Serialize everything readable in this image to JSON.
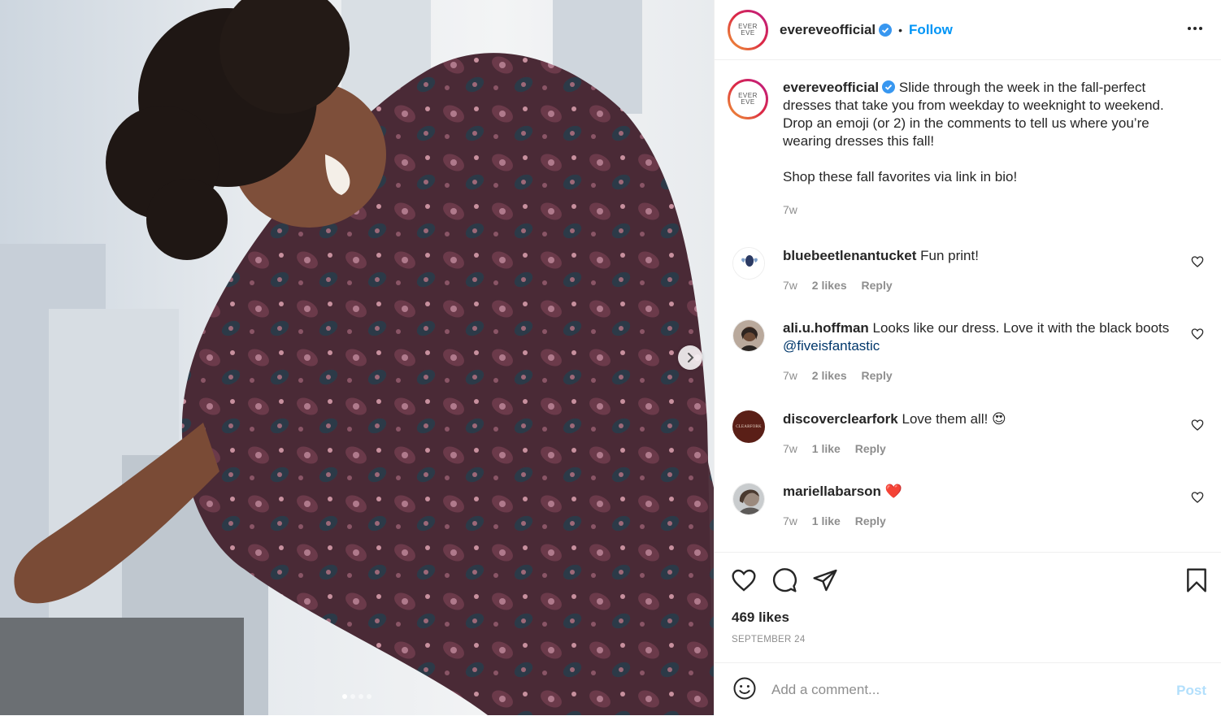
{
  "photo": {
    "alt": "",
    "carousel_dots": 4,
    "active_dot": 0
  },
  "header": {
    "avatar_text_top": "EVER",
    "avatar_text_bottom": "EVE",
    "username": "evereveofficial",
    "separator": "•",
    "follow_label": "Follow"
  },
  "caption": {
    "username": "evereveofficial",
    "text": "Slide through the week in the fall-perfect dresses that take you from weekday to weeknight to weekend. Drop an emoji (or 2) in the comments to tell us where you’re wearing dresses this fall!",
    "text2": "Shop these fall favorites via link in bio!",
    "time": "7w"
  },
  "comments": [
    {
      "username": "bluebeetlenantucket",
      "text": "Fun print!",
      "time": "7w",
      "likes": "2 likes",
      "reply": "Reply"
    },
    {
      "username": "ali.u.hoffman",
      "text": "Looks like our dress. Love it with the black boots",
      "mention": "@fiveisfantastic",
      "time": "7w",
      "likes": "2 likes",
      "reply": "Reply"
    },
    {
      "username": "discoverclearfork",
      "text": "Love them all! 😍",
      "time": "7w",
      "likes": "1 like",
      "reply": "Reply",
      "avatar_text": "CLEARFORK"
    },
    {
      "username": "mariellabarson",
      "text": "❤️",
      "time": "7w",
      "likes": "1 like",
      "reply": "Reply"
    }
  ],
  "actions": {
    "likes": "469 likes",
    "date": "SEPTEMBER 24"
  },
  "add_comment": {
    "placeholder": "Add a comment...",
    "post_label": "Post"
  },
  "colors": {
    "accent": "#0095f6",
    "muted": "#8e8e8e",
    "post_disabled": "#b2dffc"
  }
}
